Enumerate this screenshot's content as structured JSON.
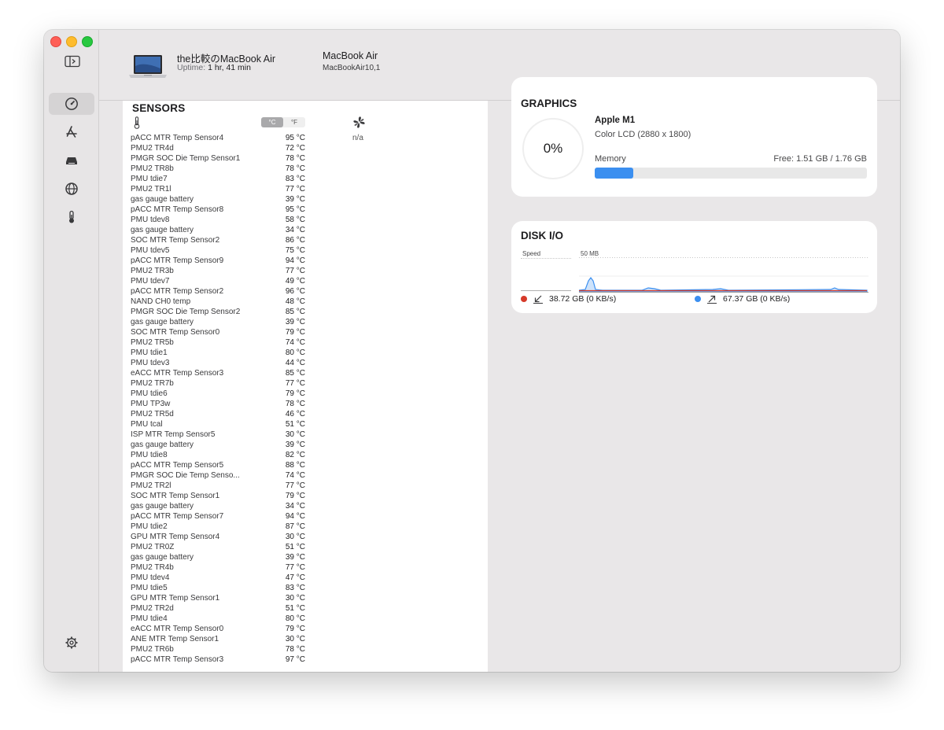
{
  "header": {
    "device_name": "the比較のMacBook Air",
    "uptime_label": "Uptime:",
    "uptime_value": "1 hr, 41 min",
    "model_name": "MacBook Air",
    "model_id": "MacBookAir10,1"
  },
  "sidebar": {
    "items": [
      {
        "icon": "gauge-icon",
        "active": true
      },
      {
        "icon": "app-store-icon",
        "active": false
      },
      {
        "icon": "disk-drive-icon",
        "active": false
      },
      {
        "icon": "globe-icon",
        "active": false
      },
      {
        "icon": "thermometer-icon",
        "active": false
      }
    ],
    "settings_icon": "gear-icon"
  },
  "sensors": {
    "title": "SENSORS",
    "unit_celsius": "°C",
    "unit_fahrenheit": "°F",
    "selected_unit": "°C",
    "fan_value": "n/a",
    "rows": [
      {
        "name": "pACC MTR Temp Sensor4",
        "value": "95 °C"
      },
      {
        "name": "PMU2 TR4d",
        "value": "72 °C"
      },
      {
        "name": "PMGR SOC Die Temp Sensor1",
        "value": "78 °C"
      },
      {
        "name": "PMU2 TR8b",
        "value": "78 °C"
      },
      {
        "name": "PMU tdie7",
        "value": "83 °C"
      },
      {
        "name": "PMU2 TR1l",
        "value": "77 °C"
      },
      {
        "name": "gas gauge battery",
        "value": "39 °C"
      },
      {
        "name": "pACC MTR Temp Sensor8",
        "value": "95 °C"
      },
      {
        "name": "PMU tdev8",
        "value": "58 °C"
      },
      {
        "name": "gas gauge battery",
        "value": "34 °C"
      },
      {
        "name": "SOC MTR Temp Sensor2",
        "value": "86 °C"
      },
      {
        "name": "PMU tdev5",
        "value": "75 °C"
      },
      {
        "name": "pACC MTR Temp Sensor9",
        "value": "94 °C"
      },
      {
        "name": "PMU2 TR3b",
        "value": "77 °C"
      },
      {
        "name": "PMU tdev7",
        "value": "49 °C"
      },
      {
        "name": "pACC MTR Temp Sensor2",
        "value": "96 °C"
      },
      {
        "name": "NAND CH0 temp",
        "value": "48 °C"
      },
      {
        "name": "PMGR SOC Die Temp Sensor2",
        "value": "85 °C"
      },
      {
        "name": "gas gauge battery",
        "value": "39 °C"
      },
      {
        "name": "SOC MTR Temp Sensor0",
        "value": "79 °C"
      },
      {
        "name": "PMU2 TR5b",
        "value": "74 °C"
      },
      {
        "name": "PMU tdie1",
        "value": "80 °C"
      },
      {
        "name": "PMU tdev3",
        "value": "44 °C"
      },
      {
        "name": "eACC MTR Temp Sensor3",
        "value": "85 °C"
      },
      {
        "name": "PMU2 TR7b",
        "value": "77 °C"
      },
      {
        "name": "PMU tdie6",
        "value": "79 °C"
      },
      {
        "name": "PMU TP3w",
        "value": "78 °C"
      },
      {
        "name": "PMU2 TR5d",
        "value": "46 °C"
      },
      {
        "name": "PMU tcal",
        "value": "51 °C"
      },
      {
        "name": "ISP MTR Temp Sensor5",
        "value": "30 °C"
      },
      {
        "name": "gas gauge battery",
        "value": "39 °C"
      },
      {
        "name": "PMU tdie8",
        "value": "82 °C"
      },
      {
        "name": "pACC MTR Temp Sensor5",
        "value": "88 °C"
      },
      {
        "name": "PMGR SOC Die Temp Senso...",
        "value": "74 °C"
      },
      {
        "name": "PMU2 TR2l",
        "value": "77 °C"
      },
      {
        "name": "SOC MTR Temp Sensor1",
        "value": "79 °C"
      },
      {
        "name": "gas gauge battery",
        "value": "34 °C"
      },
      {
        "name": "pACC MTR Temp Sensor7",
        "value": "94 °C"
      },
      {
        "name": "PMU tdie2",
        "value": "87 °C"
      },
      {
        "name": "GPU MTR Temp Sensor4",
        "value": "30 °C"
      },
      {
        "name": "PMU2 TR0Z",
        "value": "51 °C"
      },
      {
        "name": "gas gauge battery",
        "value": "39 °C"
      },
      {
        "name": "PMU2 TR4b",
        "value": "77 °C"
      },
      {
        "name": "PMU tdev4",
        "value": "47 °C"
      },
      {
        "name": "PMU tdie5",
        "value": "83 °C"
      },
      {
        "name": "GPU MTR Temp Sensor1",
        "value": "30 °C"
      },
      {
        "name": "PMU2 TR2d",
        "value": "51 °C"
      },
      {
        "name": "PMU tdie4",
        "value": "80 °C"
      },
      {
        "name": "eACC MTR Temp Sensor0",
        "value": "79 °C"
      },
      {
        "name": "ANE MTR Temp Sensor1",
        "value": "30 °C"
      },
      {
        "name": "PMU2 TR6b",
        "value": "78 °C"
      },
      {
        "name": "pACC MTR Temp Sensor3",
        "value": "97 °C"
      }
    ]
  },
  "graphics": {
    "title": "GRAPHICS",
    "usage": "0%",
    "gpu_name": "Apple M1",
    "display": "Color LCD (2880 x 1800)",
    "memory_label": "Memory",
    "memory_free": "Free: 1.51 GB / 1.76 GB",
    "memory_used_fraction": 0.142
  },
  "disk": {
    "title": "DISK I/O",
    "speed_label": "Speed",
    "scale_label": "50 MB",
    "read_total": "38.72 GB (0 KB/s)",
    "write_total": "67.37 GB (0 KB/s)",
    "read_color": "#d63a2a",
    "write_color": "#3b8ff0"
  }
}
